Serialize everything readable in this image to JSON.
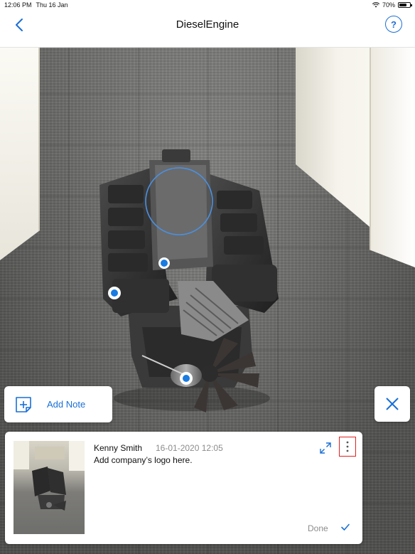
{
  "status_bar": {
    "time": "12:06 PM",
    "date": "Thu 16 Jan",
    "battery": "70%",
    "battery_level": 0.7,
    "icons": [
      "wifi-icon",
      "battery-icon"
    ]
  },
  "nav": {
    "title": "DieselEngine",
    "back_icon": "chevron-left-icon",
    "help_label": "?"
  },
  "add_note": {
    "label": "Add Note",
    "icon": "add-note-icon"
  },
  "close": {
    "icon": "close-icon"
  },
  "note": {
    "author": "Kenny Smith",
    "date": "16-01-2020 12:05",
    "text": "Add company’s logo here.",
    "done_label": "Done",
    "icons": [
      "expand-icon",
      "more-vertical-icon",
      "checkmark-icon"
    ]
  },
  "colors": {
    "accent": "#1a6fd6",
    "highlight_border": "#e02020",
    "muted_text": "#8c8c8c"
  }
}
